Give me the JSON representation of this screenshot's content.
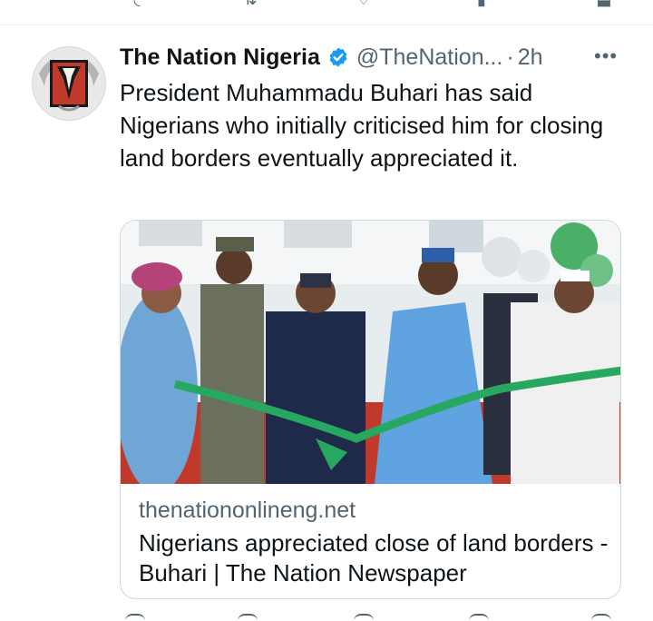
{
  "tweet": {
    "display_name": "The Nation Nigeria",
    "handle": "@TheNation...",
    "separator": "·",
    "time": "2h",
    "more_icon": "more-horizontal-icon",
    "verified_color": "#1d9bf0",
    "text": "President Muhammadu Buhari has said Nigerians who initially criticised him for closing land borders eventually appreciated it."
  },
  "card": {
    "image_description_icon": "ribbon-cutting-photo",
    "domain": "thenationonlineng.net",
    "title": "Nigerians appreciated close of land borders - Buhari | The Nation Newspaper"
  },
  "colors": {
    "text_primary": "#0f1419",
    "text_secondary": "#536471",
    "border": "#cfd9de",
    "accent": "#1d9bf0"
  }
}
